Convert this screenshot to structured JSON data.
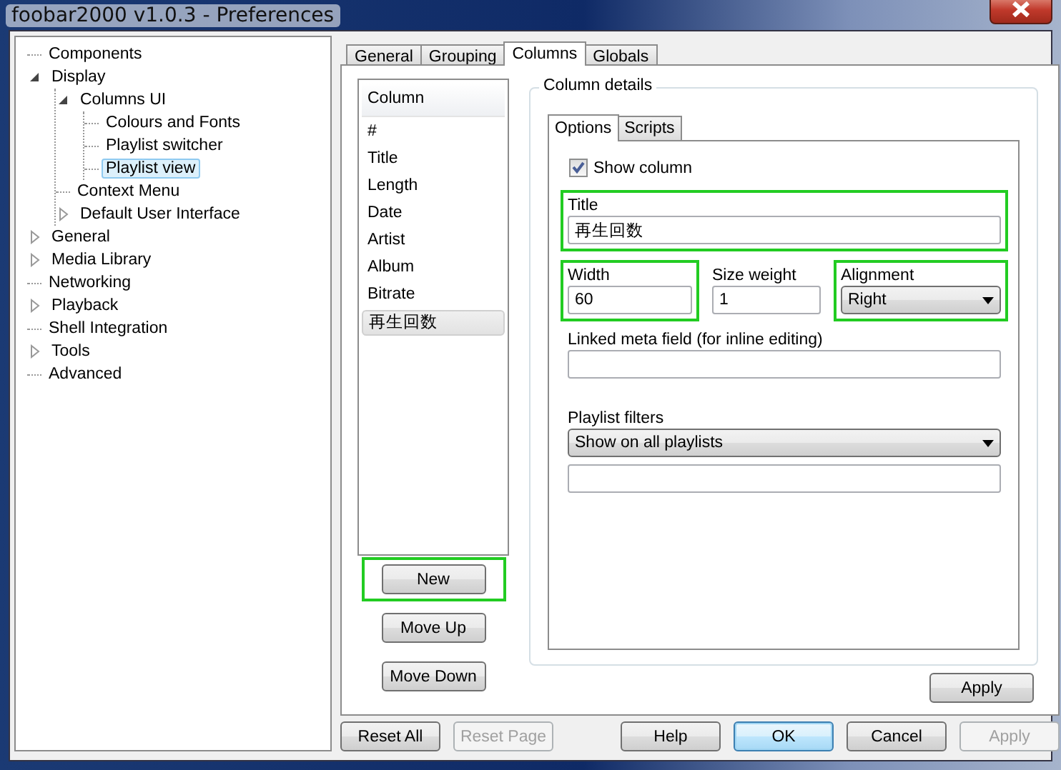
{
  "window": {
    "title": "foobar2000 v1.0.3 - Preferences"
  },
  "tree": [
    {
      "label": "Components",
      "selected": false
    },
    {
      "label": "Display",
      "selected": false,
      "expanded": true,
      "children": [
        {
          "label": "Columns UI",
          "selected": false,
          "expanded": true,
          "children": [
            {
              "label": "Colours and Fonts",
              "selected": false
            },
            {
              "label": "Playlist switcher",
              "selected": false
            },
            {
              "label": "Playlist view",
              "selected": true
            }
          ]
        },
        {
          "label": "Context Menu",
          "selected": false
        },
        {
          "label": "Default User Interface",
          "selected": false,
          "expanded": false
        }
      ]
    },
    {
      "label": "General",
      "selected": false,
      "expanded": false
    },
    {
      "label": "Media Library",
      "selected": false,
      "expanded": false
    },
    {
      "label": "Networking",
      "selected": false
    },
    {
      "label": "Playback",
      "selected": false,
      "expanded": false
    },
    {
      "label": "Shell Integration",
      "selected": false
    },
    {
      "label": "Tools",
      "selected": false,
      "expanded": false
    },
    {
      "label": "Advanced",
      "selected": false
    }
  ],
  "tabs": [
    {
      "label": "General",
      "selected": false
    },
    {
      "label": "Grouping",
      "selected": false
    },
    {
      "label": "Columns",
      "selected": true
    },
    {
      "label": "Globals",
      "selected": false
    }
  ],
  "column_list": {
    "header": "Column",
    "items": [
      {
        "label": "#",
        "selected": false
      },
      {
        "label": "Title",
        "selected": false
      },
      {
        "label": "Length",
        "selected": false
      },
      {
        "label": "Date",
        "selected": false
      },
      {
        "label": "Artist",
        "selected": false
      },
      {
        "label": "Album",
        "selected": false
      },
      {
        "label": "Bitrate",
        "selected": false
      },
      {
        "label": "再生回数",
        "selected": true
      }
    ]
  },
  "list_buttons": [
    {
      "label": "New",
      "highlighted": true
    },
    {
      "label": "Move Up",
      "highlighted": false
    },
    {
      "label": "Move Down",
      "highlighted": false
    }
  ],
  "details": {
    "title": "Column details",
    "subtabs": [
      {
        "label": "Options",
        "selected": true
      },
      {
        "label": "Scripts",
        "selected": false
      }
    ],
    "show_column": {
      "label": "Show column",
      "checked": true
    },
    "title_field": {
      "label": "Title",
      "value": "再生回数",
      "highlighted": true
    },
    "width_field": {
      "label": "Width",
      "value": "60",
      "highlighted": true
    },
    "size_weight_field": {
      "label": "Size weight",
      "value": "1",
      "highlighted": false
    },
    "alignment": {
      "label": "Alignment",
      "value": "Right",
      "highlighted": true
    },
    "linked_meta_field": {
      "label": "Linked meta field (for inline editing)"
    },
    "playlist_filters": {
      "label": "Playlist filters",
      "value": "Show on all playlists"
    }
  },
  "apply_button": {
    "label": "Apply"
  },
  "footer_buttons": [
    {
      "label": "Reset All",
      "disabled": false,
      "default": false
    },
    {
      "label": "Reset Page",
      "disabled": true,
      "default": false
    },
    {
      "label": "Help",
      "disabled": false,
      "default": false
    },
    {
      "label": "OK",
      "disabled": false,
      "default": true
    },
    {
      "label": "Cancel",
      "disabled": false,
      "default": false
    },
    {
      "label": "Apply",
      "disabled": true,
      "default": false
    }
  ]
}
